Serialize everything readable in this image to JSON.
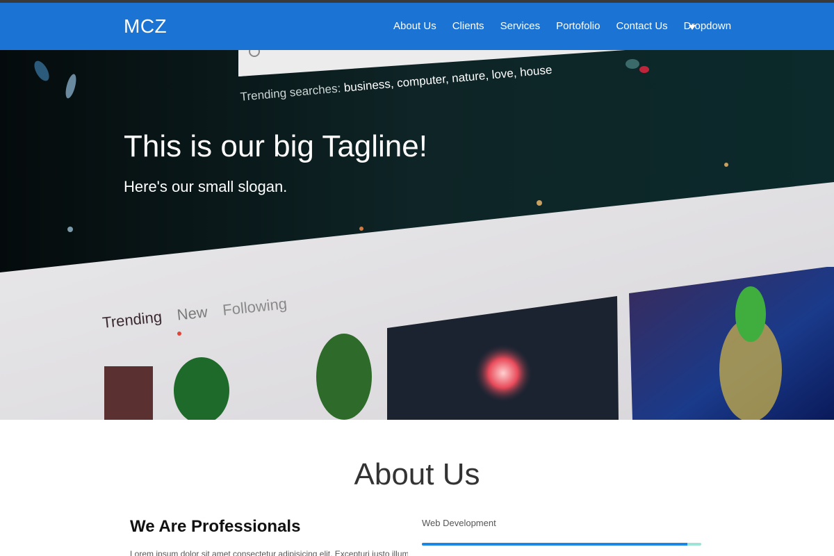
{
  "navbar": {
    "brand": "MCZ",
    "links": [
      {
        "label": "About Us"
      },
      {
        "label": "Clients"
      },
      {
        "label": "Services"
      },
      {
        "label": "Portofolio"
      },
      {
        "label": "Contact Us"
      },
      {
        "label": "Dropdown"
      }
    ],
    "dropdown_icon": "caret-down-icon"
  },
  "hero": {
    "tagline": "This is our big Tagline!",
    "slogan": "Here's our small slogan.",
    "background": {
      "trending_prefix": "Trending searches:",
      "trending_terms": "business, computer, nature, love, house",
      "tabs": [
        "Trending",
        "New",
        "Following"
      ],
      "search_icon": "search-icon"
    }
  },
  "about": {
    "heading": "About Us",
    "subheading": "We Are Professionals",
    "body": "Lorem ipsum dolor sit amet consectetur adipisicing elit. Excepturi iusto illum quia",
    "skills": [
      {
        "label": "Web Development",
        "percent": 95
      }
    ]
  },
  "colors": {
    "navbar": "#1b73d4",
    "progress_fill": "#1b86e3",
    "progress_track": "#9ee3d8"
  }
}
